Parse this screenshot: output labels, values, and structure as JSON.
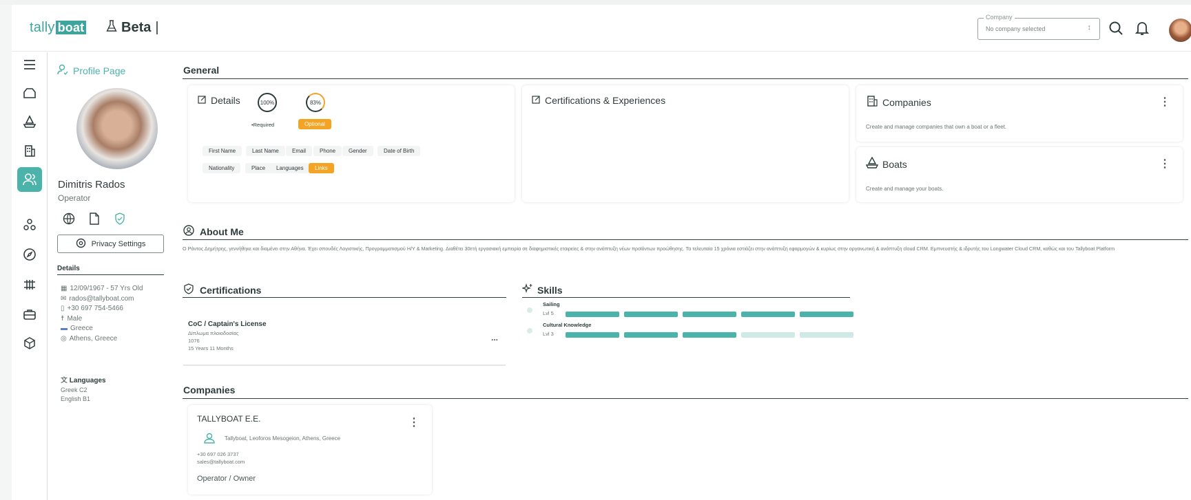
{
  "header": {
    "logo_text": "tally",
    "logo_highlight": "boat",
    "beta_label": "Beta",
    "company_label": "Company",
    "company_value": "No company selected"
  },
  "profile": {
    "page_link": "Profile Page",
    "name": "Dimitris Rados",
    "role": "Operator",
    "privacy_button": "Privacy Settings",
    "details_header": "Details",
    "details": [
      "12/09/1967 - 57 Yrs Old",
      "rados@tallyboat.com",
      "+30 697 754-5466",
      "Male",
      "Greece",
      "Athens, Greece"
    ],
    "languages_header": "Languages",
    "languages": [
      "Greek C2",
      "English B1"
    ]
  },
  "general": {
    "title": "General",
    "details_card": {
      "title": "Details",
      "required_pct": "100%",
      "optional_pct": "83%",
      "required_label": "•Required",
      "optional_label": "Optional",
      "fields": [
        "First Name",
        "Last Name",
        "Email",
        "Phone",
        "Gender",
        "Date of Birth",
        "Nationality",
        "Place",
        "Languages",
        "Links"
      ]
    },
    "certs_card": {
      "title": "Certifications & Experiences"
    },
    "companies_card": {
      "title": "Companies",
      "desc": "Create and manage companies that own a boat or a fleet."
    },
    "boats_card": {
      "title": "Boats",
      "desc": "Create and manage your boats."
    }
  },
  "about": {
    "title": "About Me",
    "text": "Ο Ράντος Δημήτρης, γεννήθηκε και διαμένει στην Αθήνα. Έχει σπουδές Λογιστικής, Προγραμματισμού Η/Υ & Marketing. Διαθέτει 30ετή εργασιακή εμπειρία σε διαφημιστικές εταιρείες & στην ανάπτυξη νέων προϊόντων προώθησης. Τα τελευταία 15 χρόνια εστιάζει στην ανάπτυξη εφαρμογών & κυρίως στην οργανωτική & ανάπτυξη cloud CRM. Εμπνευστής & ιδρυτής του Longwater Cloud CRM, καθώς και του Tallyboat Platform"
  },
  "certifications": {
    "title": "Certifications",
    "items": [
      {
        "name": "CoC / Captain's License",
        "subtitle": "Δίπλωμα πλοιοδοσίας",
        "number": "1076",
        "duration": "15 Years 11 Months",
        "menu": "..."
      }
    ]
  },
  "skills": {
    "title": "Skills",
    "items": [
      {
        "name": "Sailing",
        "level_label": "Lvl 5",
        "level": 5,
        "max": 5
      },
      {
        "name": "Cultural Knowledge",
        "level_label": "Lvl 3",
        "level": 3,
        "max": 5
      }
    ]
  },
  "companies": {
    "title": "Companies",
    "items": [
      {
        "name": "TALLYBOAT E.E.",
        "address": "Tallyboat, Leoforos Mesogeion, Athens, Greece",
        "phone": "+30 697 026 3737",
        "email": "sales@tallyboat.com",
        "role": "Operator / Owner"
      }
    ]
  },
  "colors": {
    "accent": "#4cb3aa",
    "warning": "#f4a425",
    "text": "#2e3b3b",
    "skill_empty": "#cfe9e6"
  },
  "icons": [
    "search-icon",
    "bell-icon",
    "menu-icon",
    "globe-icon",
    "document-icon",
    "shield-icon"
  ]
}
